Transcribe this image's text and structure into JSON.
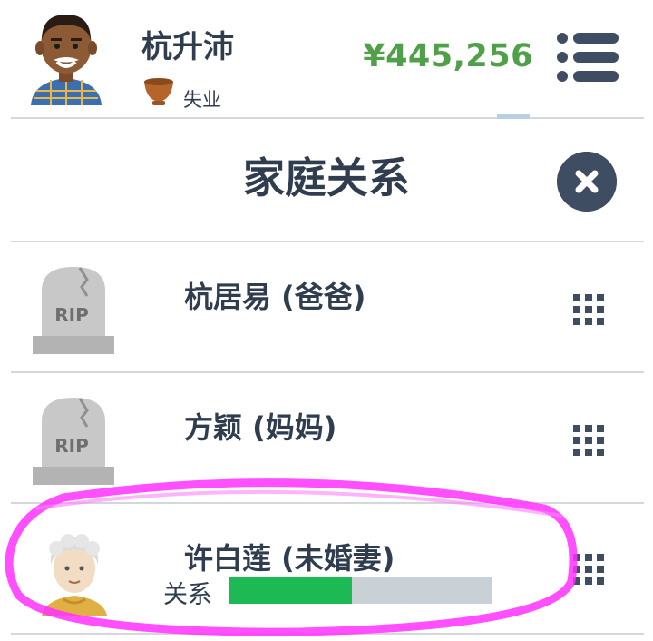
{
  "header": {
    "name": "杭升沛",
    "job": "失业",
    "money": "¥445,256",
    "avatar_icon": "man-avatar-icon",
    "job_icon": "bowl-icon",
    "menu_icon": "hamburger-menu-icon"
  },
  "dialog": {
    "title": "家庭关系",
    "close_icon": "close-icon"
  },
  "relatives": [
    {
      "name": "杭居易 (爸爸)",
      "icon": "rip-tombstone-icon",
      "tombstone_text": "RIP",
      "deceased": true
    },
    {
      "name": "方颖 (妈妈)",
      "icon": "rip-tombstone-icon",
      "tombstone_text": "RIP",
      "deceased": true
    },
    {
      "name": "许白莲 (未婚妻)",
      "icon": "old-woman-avatar-icon",
      "relationship_label": "关系",
      "relationship_level": 0.47
    }
  ],
  "colors": {
    "text": "#2f3d4f",
    "money": "#4fa048",
    "relationship_fill": "#1db954",
    "relationship_track": "#c9d1d7",
    "highlight": "#ff30ff"
  }
}
